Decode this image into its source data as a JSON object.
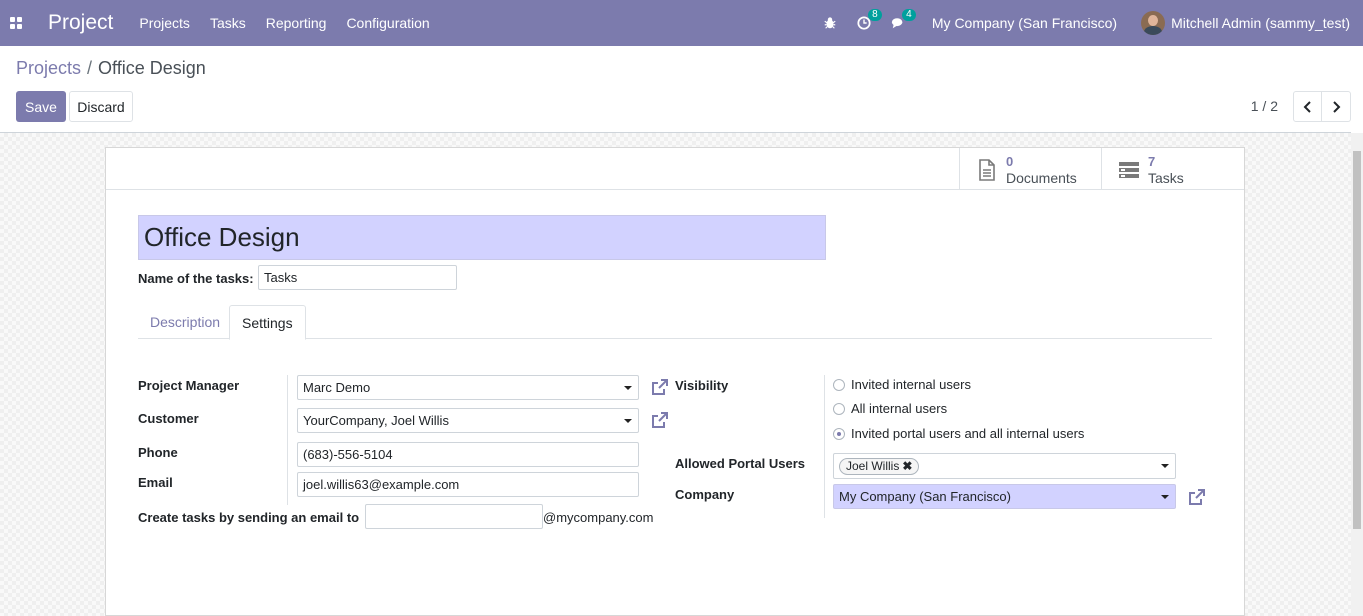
{
  "navbar": {
    "app_name": "Project",
    "menu": [
      "Projects",
      "Tasks",
      "Reporting",
      "Configuration"
    ],
    "activity_count": "8",
    "messages_count": "4",
    "company": "My Company (San Francisco)",
    "user": "Mitchell Admin (sammy_test)"
  },
  "breadcrumb": {
    "parent": "Projects",
    "separator": "/",
    "current": "Office Design"
  },
  "actions": {
    "save": "Save",
    "discard": "Discard"
  },
  "pager": {
    "value": "1 / 2"
  },
  "smart_buttons": {
    "documents": {
      "value": "0",
      "label": "Documents"
    },
    "tasks": {
      "value": "7",
      "label": "Tasks"
    }
  },
  "form": {
    "name": "Office Design",
    "task_name_label": "Name of the tasks:",
    "task_name_value": "Tasks"
  },
  "tabs": {
    "description": "Description",
    "settings": "Settings"
  },
  "settings": {
    "project_manager_label": "Project Manager",
    "project_manager_value": "Marc Demo",
    "customer_label": "Customer",
    "customer_value": "YourCompany, Joel Willis",
    "phone_label": "Phone",
    "phone_value": "(683)-556-5104",
    "email_label": "Email",
    "email_value": "joel.willis63@example.com",
    "alias_label": "Create tasks by sending an email",
    "alias_to": "to",
    "alias_value": "",
    "alias_domain": "@mycompany.com",
    "visibility_label": "Visibility",
    "visibility_options": [
      {
        "label": "Invited internal users",
        "checked": false
      },
      {
        "label": "All internal users",
        "checked": false
      },
      {
        "label": "Invited portal users and all internal users",
        "checked": true
      }
    ],
    "portal_users_label": "Allowed Portal Users",
    "portal_users_tags": [
      "Joel Willis"
    ],
    "company_label": "Company",
    "company_value": "My Company (San Francisco)"
  },
  "icons": {
    "apps": "apps-grid-icon",
    "bug": "bug-icon",
    "activity": "clock-icon",
    "messages": "chat-icon",
    "documents": "file-icon",
    "tasks": "tasks-list-icon",
    "external": "external-link-icon"
  },
  "colors": {
    "brand": "#7c7bad",
    "title_bg": "#d2d2ff",
    "badge": "#00a09d"
  }
}
